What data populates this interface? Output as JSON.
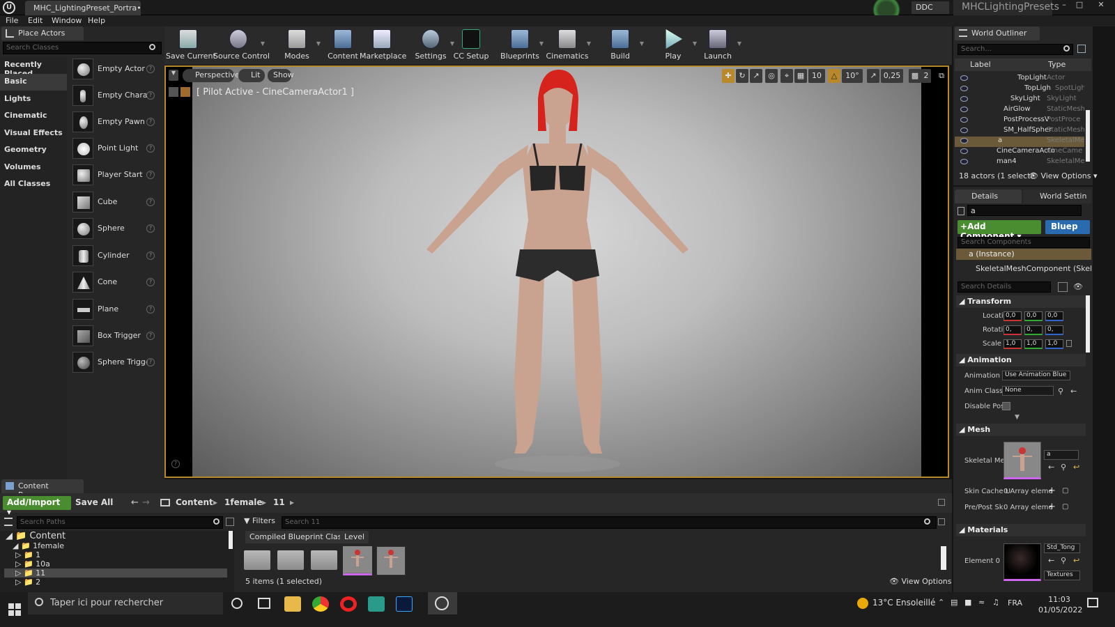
{
  "window": {
    "tab_title": "MHC_LightingPreset_Portra•",
    "ddc": "DDC",
    "project": "MHCLightingPresets"
  },
  "menu": [
    "File",
    "Edit",
    "Window",
    "Help"
  ],
  "place_actors": {
    "tab": "Place Actors",
    "search_placeholder": "Search Classes",
    "categories": [
      "Recently Placed",
      "Basic",
      "Lights",
      "Cinematic",
      "Visual Effects",
      "Geometry",
      "Volumes",
      "All Classes"
    ],
    "actors": [
      "Empty Actor",
      "Empty Charact",
      "Empty Pawn",
      "Point Light",
      "Player Start",
      "Cube",
      "Sphere",
      "Cylinder",
      "Cone",
      "Plane",
      "Box Trigger",
      "Sphere Trigger"
    ]
  },
  "toolbar": [
    "Save Current",
    "Source Control",
    "Modes",
    "Content",
    "Marketplace",
    "Settings",
    "CC Setup",
    "Blueprints",
    "Cinematics",
    "Build",
    "Play",
    "Launch"
  ],
  "viewport": {
    "perspective": "Perspective",
    "lit": "Lit",
    "show": "Show",
    "pilot": "[ Pilot Active - CineCameraActor1 ]",
    "grid": "10",
    "angle": "10°",
    "scale": "0,25",
    "cam_speed": "2"
  },
  "content_browser": {
    "tab": "Content Browser",
    "add_import": "Add/Import",
    "save_all": "Save All",
    "breadcrumb": [
      "Content",
      "1female",
      "11"
    ],
    "paths_placeholder": "Search Paths",
    "tree": [
      {
        "label": "Content",
        "level": 0
      },
      {
        "label": "1female",
        "level": 1
      },
      {
        "label": "1",
        "level": 2
      },
      {
        "label": "10a",
        "level": 2
      },
      {
        "label": "11",
        "level": 2
      },
      {
        "label": "2",
        "level": 2
      }
    ],
    "filters": "Filters",
    "search_placeholder": "Search 11",
    "chips": [
      "Compiled Blueprint Class",
      "Level"
    ],
    "status": "5 items (1 selected)",
    "view_options": "View Options"
  },
  "world_outliner": {
    "tab": "World Outliner",
    "search_placeholder": "Search...",
    "col_label": "Label",
    "col_type": "Type",
    "rows": [
      {
        "label": "TopLight",
        "type": "Actor",
        "indent": 1
      },
      {
        "label": "TopLigh",
        "type": "SpotLight",
        "indent": 2
      },
      {
        "label": "SkyLight",
        "type": "SkyLight",
        "indent": 1
      },
      {
        "label": "AirGlow",
        "type": "StaticMesh",
        "indent": 0
      },
      {
        "label": "PostProcessV",
        "type": "PostProce",
        "indent": 0
      },
      {
        "label": "SM_HalfSpher",
        "type": "StaticMesh",
        "indent": 0
      },
      {
        "label": "a",
        "type": "SkeletalMe",
        "indent": 0
      },
      {
        "label": "CineCameraActo",
        "type": "CineCame",
        "indent": 0
      },
      {
        "label": "man4",
        "type": "SkeletalMe",
        "indent": 0
      }
    ],
    "status": "18 actors (1 selecte",
    "view_options": "View Options"
  },
  "details": {
    "tab": "Details",
    "tab2": "World Settin",
    "name": "a",
    "add_component": "Add Component",
    "blueprint": "Bluep",
    "comp_search": "Search Components",
    "instance": "a (Instance)",
    "component": "SkeletalMeshComponent (SkeletalMe",
    "details_search": "Search Details",
    "transform": "Transform",
    "location": "Location",
    "rotation": "Rotation",
    "scale": "Scale",
    "loc_vals": [
      "0,0",
      "0,0",
      "0,0"
    ],
    "rot_vals": [
      "0,",
      "0,",
      "0,"
    ],
    "scale_vals": [
      "1,0",
      "1,0",
      "1,0"
    ],
    "animation": "Animation",
    "anim_mode_label": "Animation M",
    "anim_mode": "Use Animation Blue",
    "anim_class_label": "Anim Class",
    "anim_class": "None",
    "disable_post": "Disable Post",
    "mesh": "Mesh",
    "skeletal_mesh_label": "Skeletal Mes",
    "skeletal_mesh": "a",
    "skin_cache_label": "Skin Cache U",
    "skin_cache": "0 Array eleme",
    "prepost_label": "Pre/Post Sk",
    "prepost": "0 Array eleme",
    "materials": "Materials",
    "element0_label": "Element 0",
    "element0": "Std_Tong",
    "textures": "Textures"
  },
  "taskbar": {
    "search_placeholder": "Taper ici pour rechercher",
    "weather": "13°C  Ensoleillé",
    "lang": "FRA",
    "time": "11:03",
    "date": "01/05/2022"
  }
}
